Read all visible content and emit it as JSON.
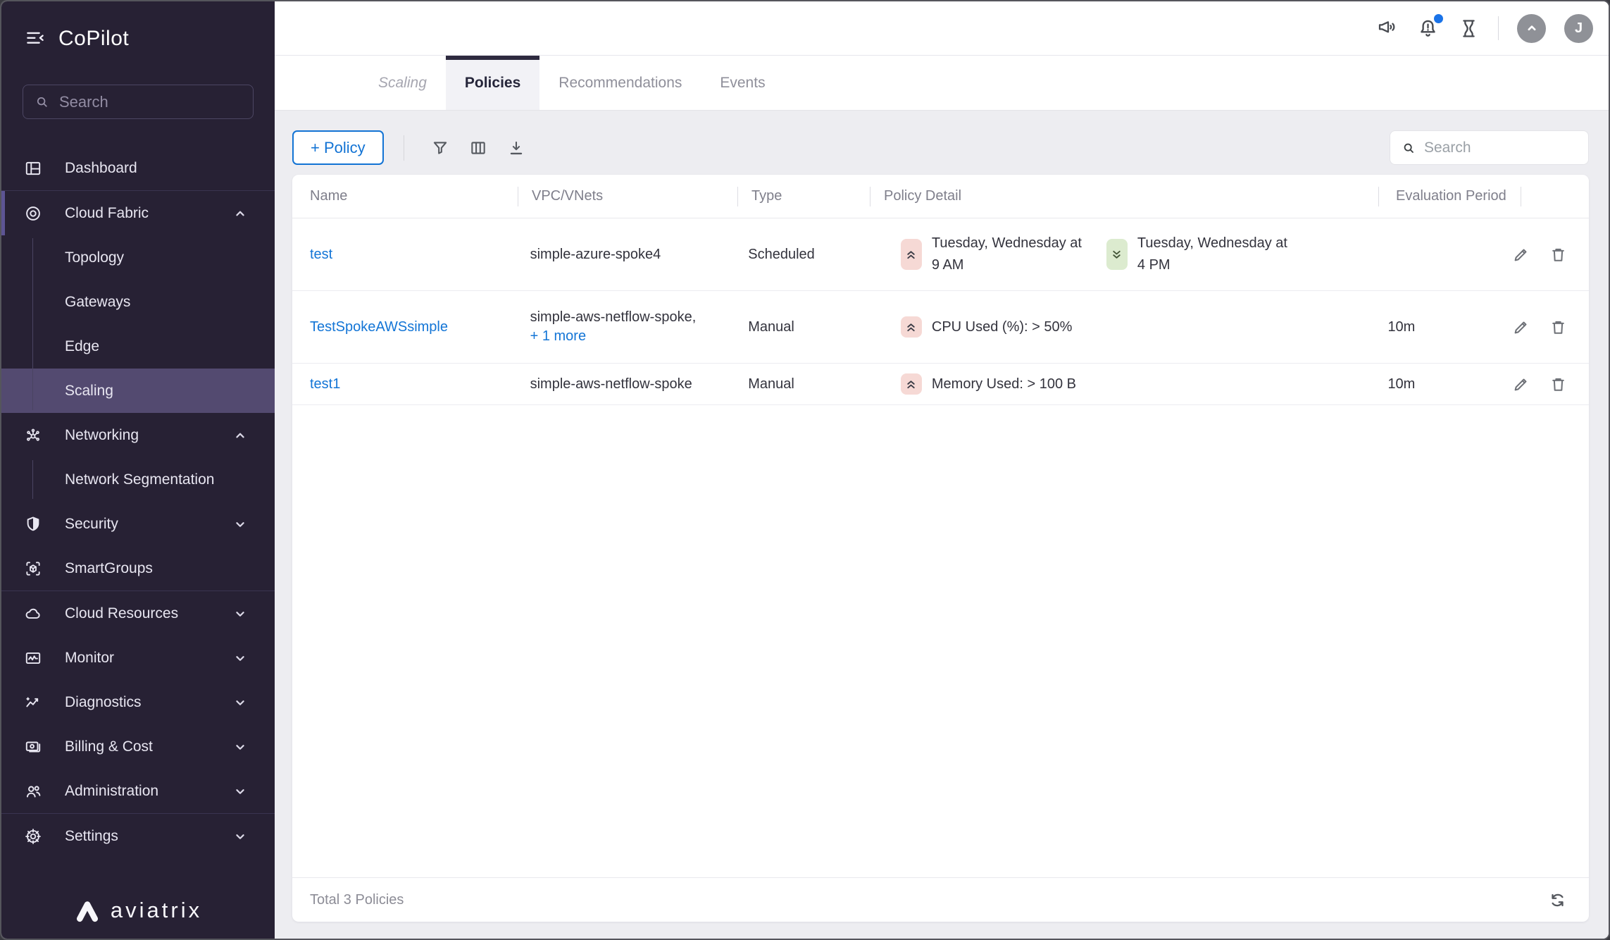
{
  "app": {
    "title": "CoPilot"
  },
  "sidebar": {
    "search_placeholder": "Search",
    "items": [
      {
        "label": "Dashboard"
      },
      {
        "label": "Cloud Fabric",
        "expanded": true,
        "children": [
          {
            "label": "Topology"
          },
          {
            "label": "Gateways"
          },
          {
            "label": "Edge"
          },
          {
            "label": "Scaling",
            "active": true
          }
        ]
      },
      {
        "label": "Networking",
        "expanded": true,
        "children": [
          {
            "label": "Network Segmentation"
          }
        ]
      },
      {
        "label": "Security",
        "expanded": false
      },
      {
        "label": "SmartGroups"
      },
      {
        "label": "Cloud Resources",
        "expanded": false
      },
      {
        "label": "Monitor",
        "expanded": false
      },
      {
        "label": "Diagnostics",
        "expanded": false
      },
      {
        "label": "Billing & Cost",
        "expanded": false
      },
      {
        "label": "Administration",
        "expanded": false
      },
      {
        "label": "Settings",
        "expanded": false
      }
    ],
    "logo_text": "aviatrix"
  },
  "topbar": {
    "icons": [
      "announcements-icon",
      "notifications-bell-icon",
      "tasks-hourglass-icon"
    ],
    "has_notification_dot": true,
    "avatar_initial": "J"
  },
  "tabs": [
    {
      "label": "Scaling",
      "state": "page-label"
    },
    {
      "label": "Policies",
      "state": "active"
    },
    {
      "label": "Recommendations",
      "state": "normal"
    },
    {
      "label": "Events",
      "state": "normal"
    }
  ],
  "toolbar": {
    "add_button_label": "+ Policy",
    "icons": [
      "filter-icon",
      "columns-icon",
      "download-icon"
    ],
    "search_placeholder": "Search"
  },
  "table": {
    "columns": [
      "Name",
      "VPC/VNets",
      "Type",
      "Policy Detail",
      "Evaluation Period"
    ],
    "rows": [
      {
        "name": "test",
        "vpc": "simple-azure-spoke4",
        "type": "Scheduled",
        "details": [
          {
            "direction": "scale-up",
            "text": "Tuesday, Wednesday at 9 AM"
          },
          {
            "direction": "scale-down",
            "text": "Tuesday, Wednesday at 4 PM"
          }
        ],
        "evaluation": ""
      },
      {
        "name": "TestSpokeAWSsimple",
        "vpc": "simple-aws-netflow-spoke,",
        "vpc_more": "+ 1 more",
        "type": "Manual",
        "details": [
          {
            "direction": "scale-up",
            "text": "CPU Used (%): > 50%"
          }
        ],
        "evaluation": "10m"
      },
      {
        "name": "test1",
        "vpc": "simple-aws-netflow-spoke",
        "type": "Manual",
        "details": [
          {
            "direction": "scale-up",
            "text": "Memory Used: > 100 B"
          }
        ],
        "evaluation": "10m"
      }
    ],
    "footer_total": "Total 3 Policies"
  },
  "colors": {
    "sidebar_bg": "#272134",
    "sidebar_active_bg": "#534a70",
    "accent_blue": "#1273d4",
    "link_blue": "#1375d6",
    "scale_up_badge_bg": "#f6d9d5",
    "scale_down_badge_bg": "#dcebcf",
    "notification_dot": "#1a73e8",
    "active_tab_topbar": "#2e2a3f"
  }
}
